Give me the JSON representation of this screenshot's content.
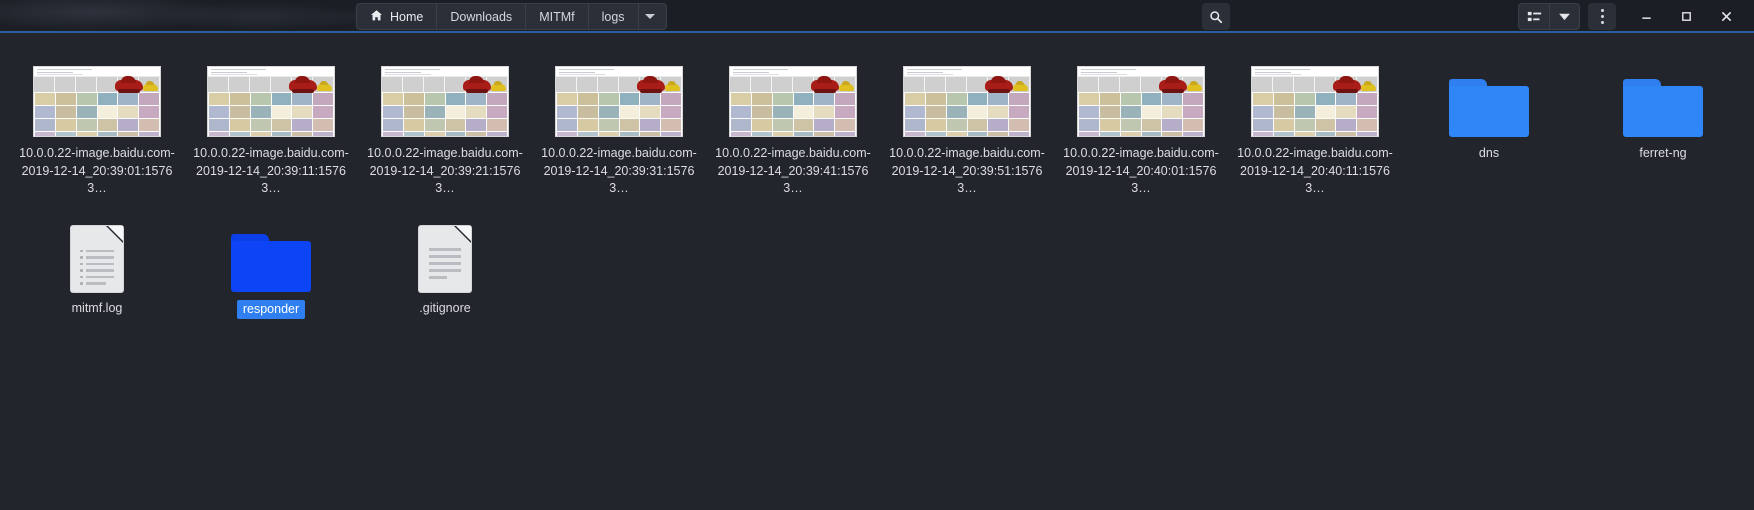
{
  "window": {
    "accent_color": "#2c5d9e",
    "background": "#22252b",
    "titlebar_background": "#1b1e24"
  },
  "breadcrumb": {
    "home_icon": "home-icon",
    "items": [
      {
        "label": "Home",
        "icon": "home-icon"
      },
      {
        "label": "Downloads",
        "icon": ""
      },
      {
        "label": "MITMf",
        "icon": ""
      },
      {
        "label": "logs",
        "icon": ""
      }
    ],
    "caret_icon": "chevron-down-icon"
  },
  "toolbar": {
    "search_icon": "search-icon",
    "view_list_icon": "list-view-icon",
    "view_dropdown_icon": "chevron-down-icon",
    "menu_icon": "kebab-menu-icon",
    "minimize_icon": "minimize-icon",
    "maximize_icon": "maximize-icon",
    "close_icon": "close-icon"
  },
  "files": {
    "row1": [
      {
        "name": "10.0.0.22-image.baidu.com-2019-12-14_20:39:01:15763…",
        "type": "image",
        "selected": false
      },
      {
        "name": "10.0.0.22-image.baidu.com-2019-12-14_20:39:11:15763…",
        "type": "image",
        "selected": false
      },
      {
        "name": "10.0.0.22-image.baidu.com-2019-12-14_20:39:21:15763…",
        "type": "image",
        "selected": false
      },
      {
        "name": "10.0.0.22-image.baidu.com-2019-12-14_20:39:31:15763…",
        "type": "image",
        "selected": false
      },
      {
        "name": "10.0.0.22-image.baidu.com-2019-12-14_20:39:41:15763…",
        "type": "image",
        "selected": false
      },
      {
        "name": "10.0.0.22-image.baidu.com-2019-12-14_20:39:51:15763…",
        "type": "image",
        "selected": false
      },
      {
        "name": "10.0.0.22-image.baidu.com-2019-12-14_20:40:01:15763…",
        "type": "image",
        "selected": false
      },
      {
        "name": "10.0.0.22-image.baidu.com-2019-12-14_20:40:11:15763…",
        "type": "image",
        "selected": false
      },
      {
        "name": "dns",
        "type": "folder",
        "selected": false
      },
      {
        "name": "ferret-ng",
        "type": "folder",
        "selected": false
      }
    ],
    "row2": [
      {
        "name": "mitmf.log",
        "type": "document",
        "selected": false
      },
      {
        "name": "responder",
        "type": "folder",
        "selected": true
      },
      {
        "name": ".gitignore",
        "type": "document",
        "selected": false
      }
    ]
  }
}
